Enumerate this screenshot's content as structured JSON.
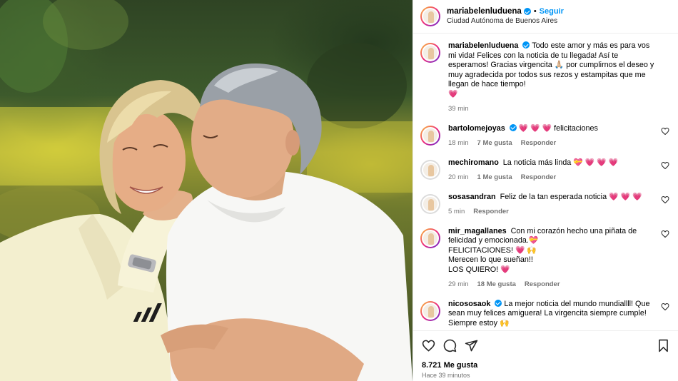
{
  "post": {
    "username": "mariabelenluduena",
    "follow_label": "Seguir",
    "dot": "•",
    "location": "Ciudad Autónoma de Buenos Aires"
  },
  "caption": {
    "username": "mariabelenluduena",
    "text_before_emoji": "Todo este amor y más es para vos mi vida! Felices con la noticia de tu llegada! Así te esperamos! Gracias virgencita",
    "emoji_pray": "🙏🏼",
    "text_after_emoji": "por cumplirnos el deseo y muy agradecida por todos sus rezos y estampitas que me llegan de hace tiempo!",
    "emoji_end": "💗",
    "time": "39 min"
  },
  "comments": [
    {
      "username": "bartolomejoyas",
      "verified": true,
      "text": "💗 💗 💗  felicitaciones",
      "time": "18 min",
      "likes": "7 Me gusta",
      "reply": "Responder"
    },
    {
      "username": "mechiromano",
      "verified": false,
      "text": "La noticia más linda 💝 💗 💗 💗",
      "time": "20 min",
      "likes": "1 Me gusta",
      "reply": "Responder"
    },
    {
      "username": "sosasandran",
      "verified": false,
      "text": "Feliz de la tan esperada noticia 💗 💗 💗",
      "time": "5 min",
      "likes": "",
      "reply": "Responder"
    },
    {
      "username": "mir_magallanes",
      "verified": false,
      "text_lines": [
        "Con mi corazón hecho una piñata de felicidad y emocionada.💝",
        "FELICITACIONES! 💗 🙌",
        "Merecen lo que sueñan!!",
        "LOS QUIERO! 💗"
      ],
      "time": "29 min",
      "likes": "18 Me gusta",
      "reply": "Responder"
    },
    {
      "username": "nicososaok",
      "verified": true,
      "text": "La mejor noticia del mundo mundiallll! Que sean muy felices amiguera! La virgencita siempre cumple! Siempre estoy 🙌",
      "time": "",
      "likes": "",
      "reply": ""
    }
  ],
  "footer": {
    "likes": "8.721 Me gusta",
    "time": "Hace 39 minutos"
  },
  "icons": {
    "like": "heart-icon",
    "comment": "comment-icon",
    "share": "share-icon",
    "save": "bookmark-icon"
  },
  "colors": {
    "accent": "#0095f6",
    "heart": "#ed4956",
    "muted": "#737373"
  }
}
